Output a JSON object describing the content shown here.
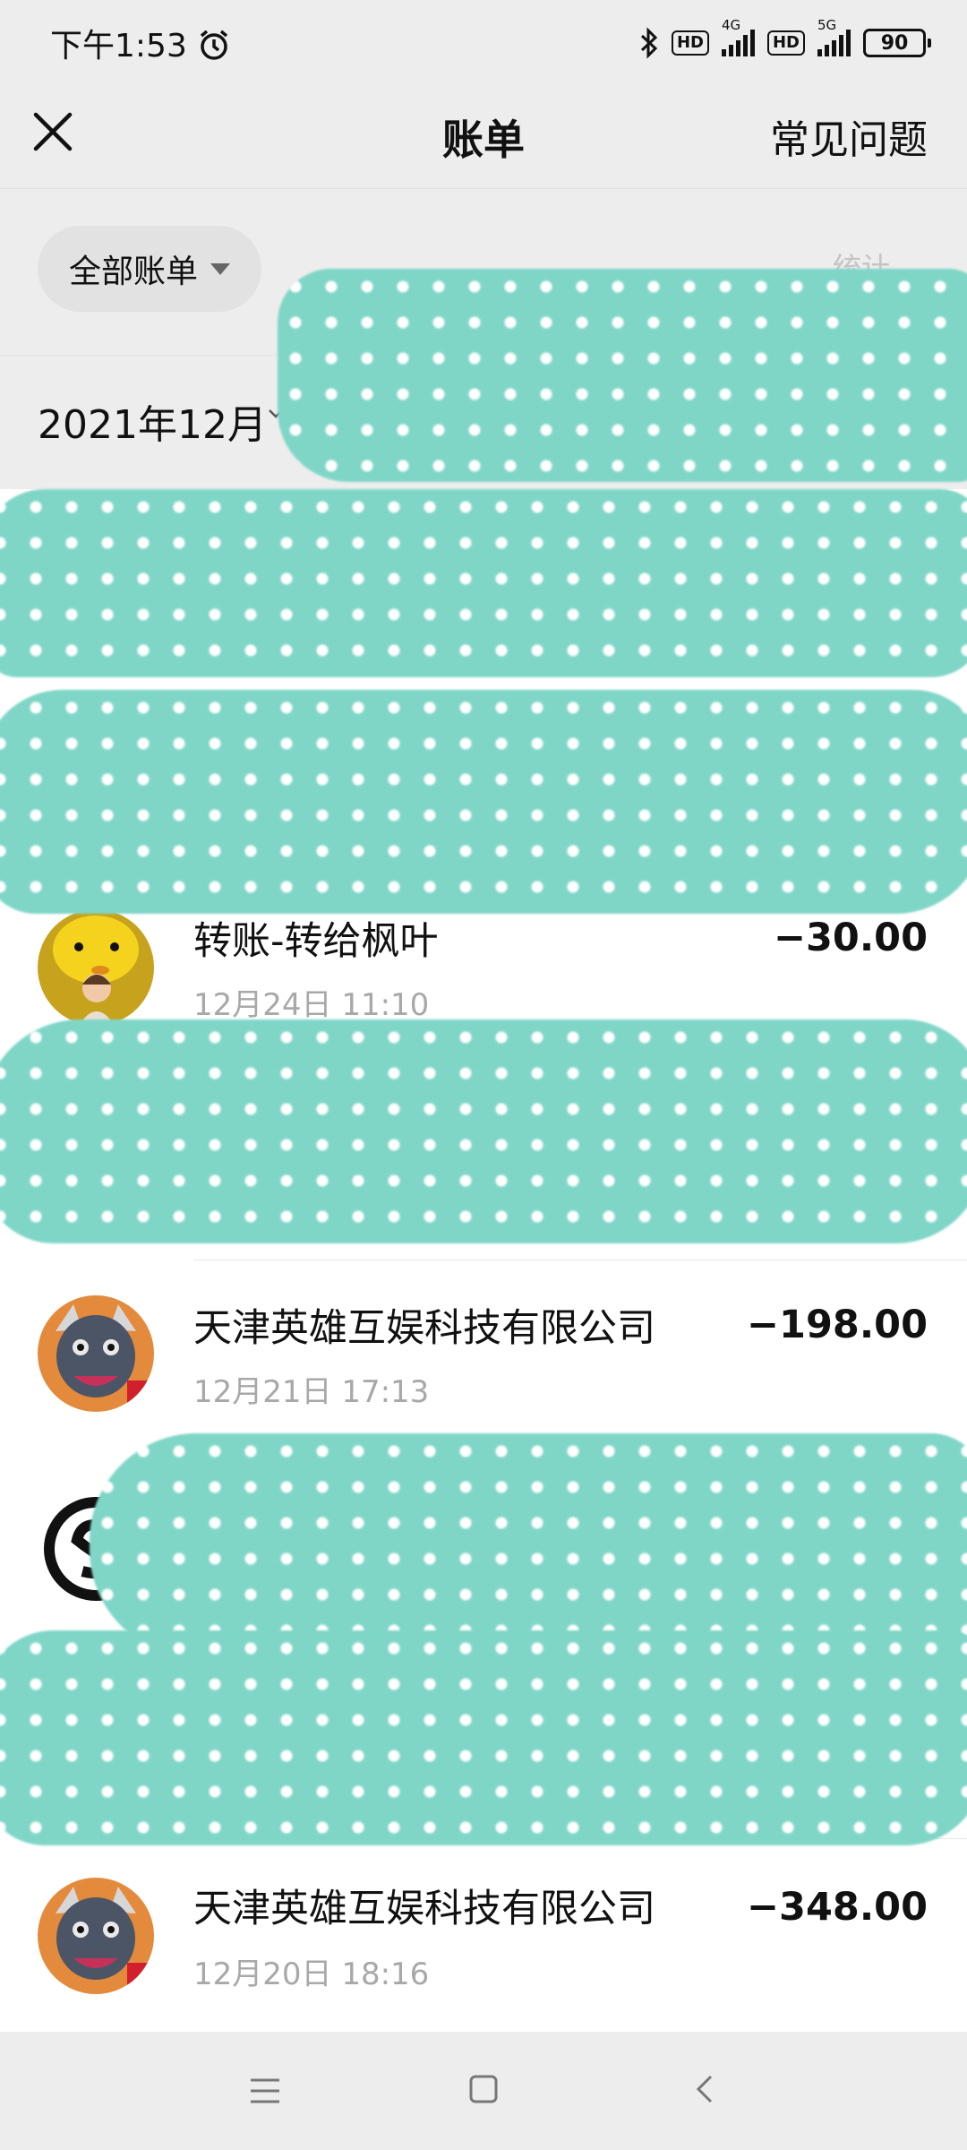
{
  "status_bar": {
    "time": "下午1:53",
    "alarm_icon": "alarm-icon",
    "bluetooth_icon": "bluetooth-icon",
    "hd1": "HD",
    "net1": "4G",
    "hd2": "HD",
    "net2": "5G",
    "battery": "90"
  },
  "header": {
    "title": "账单",
    "faq": "常见问题",
    "close_icon": "close-icon"
  },
  "filter": {
    "label": "全部账单",
    "stats_label": "统计"
  },
  "month": {
    "label": "2021年12月"
  },
  "transactions": [
    {
      "title": "转账-转给枫叶",
      "time": "12月24日 11:10",
      "amount": "−30.00"
    },
    {
      "title": "天津英雄互娱科技有限公司",
      "time": "12月21日 17:13",
      "amount": "−198.00"
    },
    {
      "title": "天津英雄互娱科技有限公司",
      "time": "12月20日 18:16",
      "amount": "−348.00"
    }
  ],
  "colors": {
    "redaction": "#7fd6c7",
    "background": "#ededed",
    "list_background": "#ffffff"
  },
  "nav": {
    "menu_icon": "menu-icon",
    "home_icon": "home-icon",
    "back_icon": "back-icon"
  }
}
